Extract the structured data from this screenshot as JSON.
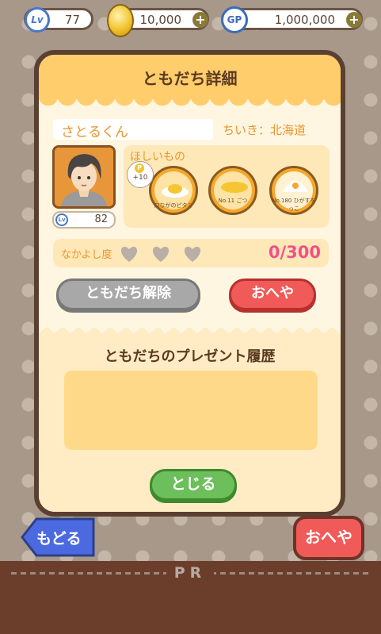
{
  "top": {
    "level": {
      "badge": "Lv",
      "value": "77"
    },
    "coins": {
      "value": "10,000"
    },
    "gp": {
      "badge": "GP",
      "value": "1,000,000"
    },
    "plus": "+"
  },
  "dialog": {
    "title": "ともだち詳細",
    "friend_name": "さとるくん",
    "region": "ちいき：北海道",
    "avatar_level": {
      "badge": "Lv",
      "value": "82"
    },
    "wants": {
      "label": "ほしいもの",
      "bonus": {
        "icon": "P",
        "text": "+10"
      },
      "items": [
        {
          "label": "口ながのピタミ"
        },
        {
          "label": "No.11 ごつ"
        },
        {
          "label": "No.180 ひがすをっこ"
        }
      ]
    },
    "friendship": {
      "label": "なかよし度",
      "hearts_filled": 0,
      "hearts_total": 3,
      "count": "0/300"
    },
    "unfriend_button": "ともだち解除",
    "room_button": "おへや",
    "history_title": "ともだちのプレゼント履歴",
    "close_button": "とじる"
  },
  "nav": {
    "back_button": "もどる",
    "room_button": "おへや"
  },
  "ad": {
    "label": "PR"
  },
  "colors": {
    "accent_orange": "#e8962c",
    "header": "#ffcd6b",
    "red": "#f05a58",
    "green": "#6cbf5a",
    "pink": "#f0508a"
  }
}
